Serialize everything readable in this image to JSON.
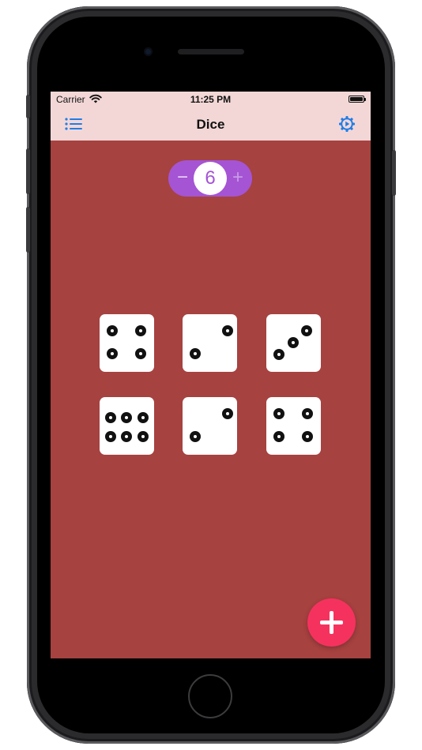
{
  "status_bar": {
    "carrier": "Carrier",
    "time": "11:25 PM",
    "wifi_icon": "wifi-icon",
    "battery_icon": "battery-icon"
  },
  "nav": {
    "title": "Dice",
    "left_icon": "list-icon",
    "right_icon": "gear-play-icon"
  },
  "stepper": {
    "minus_label": "−",
    "value": "6",
    "plus_label": "+"
  },
  "dice": [
    {
      "value": 4
    },
    {
      "value": 2
    },
    {
      "value": 3
    },
    {
      "value": 6
    },
    {
      "value": 2
    },
    {
      "value": 4
    }
  ],
  "fab": {
    "icon": "plus-icon"
  },
  "colors": {
    "background": "#a64240",
    "nav_background": "#f3d7d7",
    "accent_blue": "#1f7de6",
    "stepper_purple": "#a554d4",
    "fab_pink": "#f5325e"
  }
}
